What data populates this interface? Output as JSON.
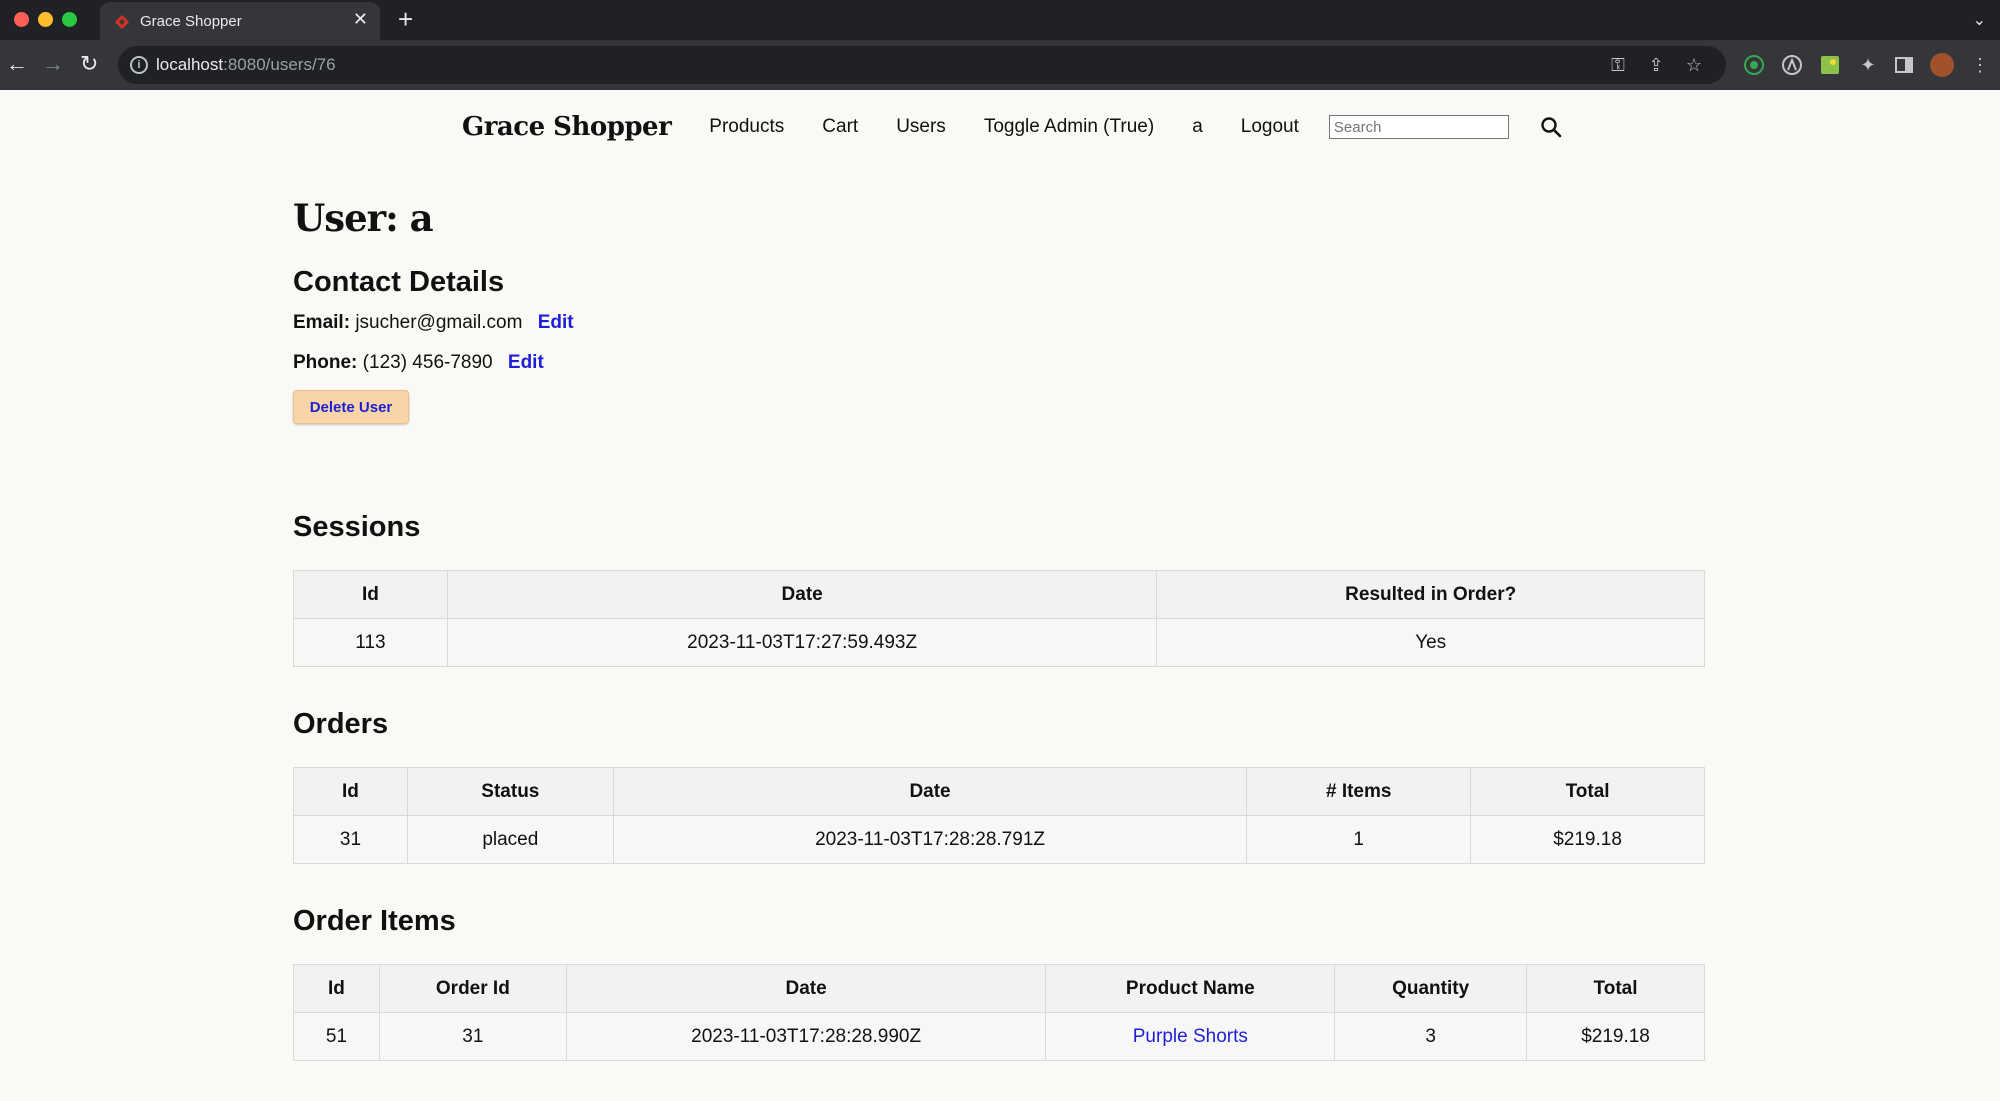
{
  "browser": {
    "tab_title": "Grace Shopper",
    "url_host": "localhost",
    "url_path": ":8080/users/76"
  },
  "nav": {
    "brand": "Grace Shopper",
    "links": [
      "Products",
      "Cart",
      "Users",
      "Toggle Admin (True)",
      "a",
      "Logout"
    ],
    "search_placeholder": "Search"
  },
  "user": {
    "heading": "User: a",
    "contact_heading": "Contact Details",
    "email_label": "Email:",
    "email": "jsucher@gmail.com",
    "phone_label": "Phone:",
    "phone": "(123) 456-7890",
    "edit_label": "Edit",
    "delete_label": "Delete User"
  },
  "sessions": {
    "heading": "Sessions",
    "headers": [
      "Id",
      "Date",
      "Resulted in Order?"
    ],
    "rows": [
      [
        "113",
        "2023-11-03T17:27:59.493Z",
        "Yes"
      ]
    ]
  },
  "orders": {
    "heading": "Orders",
    "headers": [
      "Id",
      "Status",
      "Date",
      "# Items",
      "Total"
    ],
    "rows": [
      [
        "31",
        "placed",
        "2023-11-03T17:28:28.791Z",
        "1",
        "$219.18"
      ]
    ]
  },
  "order_items": {
    "heading": "Order Items",
    "headers": [
      "Id",
      "Order Id",
      "Date",
      "Product Name",
      "Quantity",
      "Total"
    ],
    "rows": [
      [
        "51",
        "31",
        "2023-11-03T17:28:28.990Z",
        "Purple Shorts",
        "3",
        "$219.18"
      ]
    ]
  },
  "colors": {
    "link": "#1f1fd8",
    "delete_button_bg": "#f8d5a8",
    "page_bg": "#faf9f6"
  }
}
